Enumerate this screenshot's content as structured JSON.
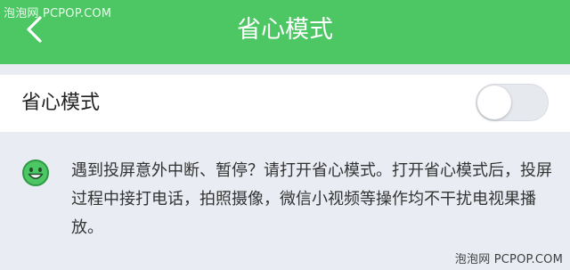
{
  "watermark": {
    "top": "泡泡网 PCPOP.COM",
    "bottom": "泡泡网 PCPOP.COM"
  },
  "header": {
    "title": "省心模式",
    "back_icon": "chevron-left-icon",
    "background_color": "#4cc764"
  },
  "setting": {
    "label": "省心模式",
    "toggle_state": "off"
  },
  "note": {
    "icon": "smiley-icon",
    "icon_color": "#4cc764",
    "text": "遇到投屏意外中断、暂停？请打开省心模式。打开省心模式后，投屏过程中接打电话，拍照摄像，微信小视频等操作均不干扰电视果播放。"
  }
}
